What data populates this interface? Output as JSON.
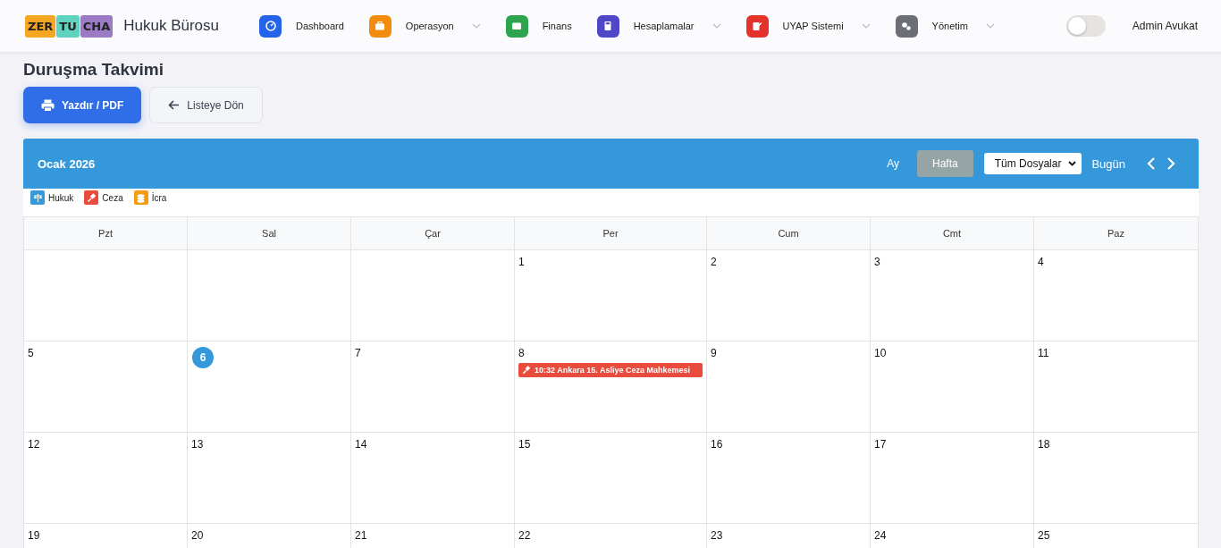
{
  "brand": {
    "logo_parts": [
      "ZER",
      "TU",
      "CHA"
    ],
    "title": "Hukuk Bürosu"
  },
  "nav": [
    {
      "label": "Dashboard",
      "color": "#2563eb",
      "kind": "gauge",
      "dropdown": false
    },
    {
      "label": "Operasyon",
      "color": "#f28c0f",
      "kind": "briefcase",
      "dropdown": true
    },
    {
      "label": "Finans",
      "color": "#2ea44f",
      "kind": "wallet",
      "dropdown": false
    },
    {
      "label": "Hesaplamalar",
      "color": "#4f46c8",
      "kind": "calculator",
      "dropdown": true
    },
    {
      "label": "UYAP Sistemi",
      "color": "#e5322d",
      "kind": "edit",
      "dropdown": true
    },
    {
      "label": "Yönetim",
      "color": "#6b6f75",
      "kind": "gears",
      "dropdown": true
    }
  ],
  "theme_toggle": {
    "on": false
  },
  "user": "Admin Avukat",
  "page_title": "Duruşma Takvimi",
  "actions": [
    {
      "label": "Yazdır / PDF",
      "kind": "print"
    },
    {
      "label": "Listeye Dön",
      "kind": "back"
    }
  ],
  "calendar": {
    "title": "Ocak 2026",
    "views": [
      {
        "label": "Ay",
        "selected": false
      },
      {
        "label": "Hafta",
        "selected": true
      }
    ],
    "filter": {
      "value": "Tüm Dosyalar"
    },
    "today_button": "Bugün",
    "legend": [
      {
        "label": "Hukuk",
        "color": "#3498db",
        "kind": "scale"
      },
      {
        "label": "Ceza",
        "color": "#e74c3c",
        "kind": "gavel"
      },
      {
        "label": "İcra",
        "color": "#f39c12",
        "kind": "coins"
      }
    ],
    "columns": [
      "Pzt",
      "Sal",
      "Çar",
      "Per",
      "Cum",
      "Cmt",
      "Paz"
    ],
    "weeks": [
      [
        {
          "day": "1"
        },
        {
          "day": "2"
        },
        {
          "day": "3"
        },
        {
          "day": "4"
        }
      ],
      [
        {
          "day": "5"
        },
        {
          "day": "6",
          "today": true
        },
        {
          "day": "7"
        },
        {
          "day": "8",
          "events": [
            {
              "text": "10:32 Ankara 15. Asliye Ceza Mahkemesi",
              "color": "#e74c3c",
              "kind": "gavel"
            }
          ]
        },
        {
          "day": "9"
        },
        {
          "day": "10"
        },
        {
          "day": "11"
        }
      ],
      [
        {
          "day": "12"
        },
        {
          "day": "13"
        },
        {
          "day": "14"
        },
        {
          "day": "15"
        },
        {
          "day": "16"
        },
        {
          "day": "17"
        },
        {
          "day": "18"
        }
      ],
      [
        {
          "day": "19"
        },
        {
          "day": "20"
        },
        {
          "day": "21"
        },
        {
          "day": "22"
        },
        {
          "day": "23"
        },
        {
          "day": "24"
        },
        {
          "day": "25"
        }
      ]
    ]
  }
}
